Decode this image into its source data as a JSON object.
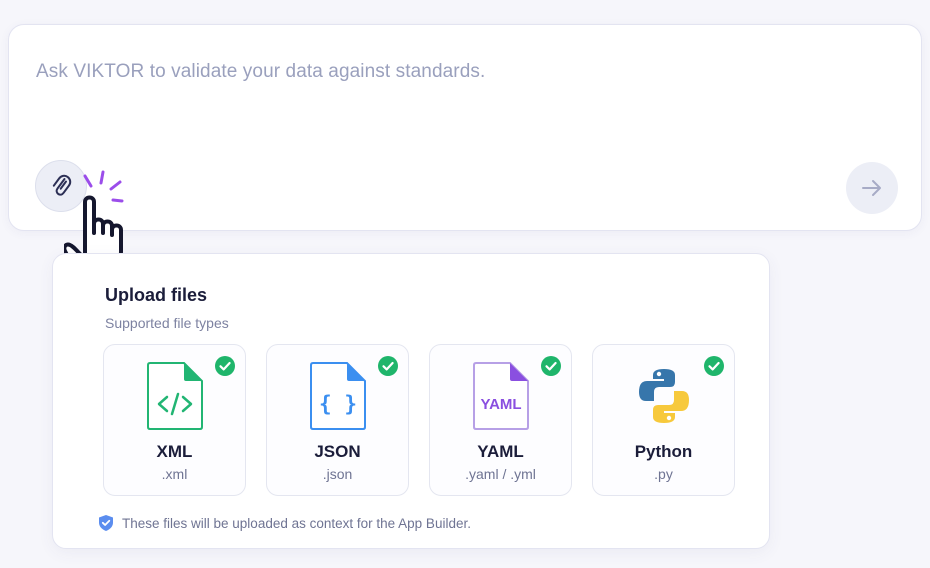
{
  "prompt": {
    "placeholder": "Ask VIKTOR to validate your data against standards."
  },
  "upload": {
    "title": "Upload files",
    "subtitle": "Supported file types",
    "file_types": [
      {
        "name": "XML",
        "ext": ".xml",
        "icon": "xml-file-icon",
        "color": "#22b573",
        "supported": true
      },
      {
        "name": "JSON",
        "ext": ".json",
        "icon": "json-file-icon",
        "color": "#3b8ff0",
        "supported": true
      },
      {
        "name": "YAML",
        "ext": ".yaml / .yml",
        "icon": "yaml-file-icon",
        "icon_text": "YAML",
        "color": "#8a4fe0",
        "supported": true
      },
      {
        "name": "Python",
        "ext": ".py",
        "icon": "python-logo-icon",
        "color": "#3776ab",
        "supported": true
      }
    ],
    "note": "These files will be uploaded as context for the App Builder."
  },
  "icons": {
    "attach": "paperclip-icon",
    "send": "arrow-right-icon",
    "pointer": "hand-pointer-icon",
    "check": "check-circle-icon",
    "shield": "shield-check-icon"
  },
  "colors": {
    "check": "#1fb56b",
    "accent": "#9b4dea",
    "placeholder": "#9aa0bd"
  }
}
